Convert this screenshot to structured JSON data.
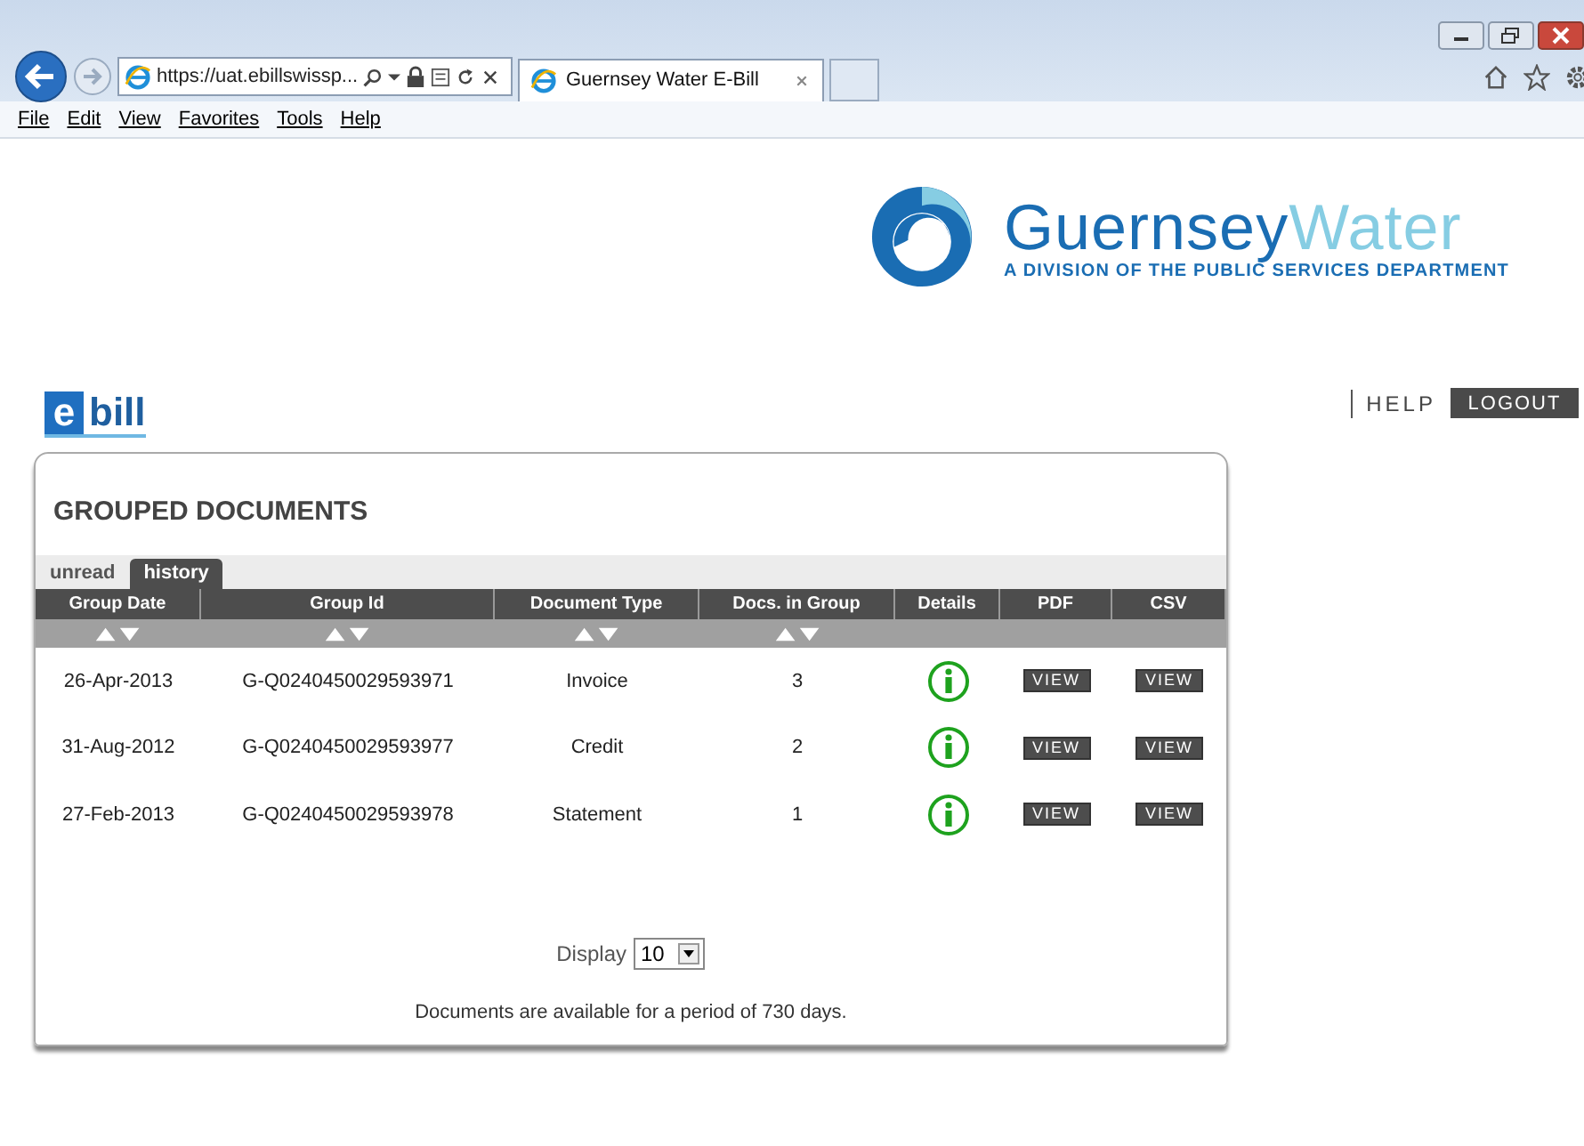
{
  "browser": {
    "address": "https://uat.ebillswissp...",
    "tab_title": "Guernsey Water E-Bill",
    "menu": [
      "File",
      "Edit",
      "View",
      "Favorites",
      "Tools",
      "Help"
    ]
  },
  "logo": {
    "name_part_1": "Guernsey",
    "name_part_2": "Water",
    "tagline": "A DIVISION OF THE PUBLIC SERVICES DEPARTMENT"
  },
  "ebill_logo": {
    "letter": "e",
    "word": "bill"
  },
  "top_links": {
    "help": "HELP",
    "logout": "LOGOUT"
  },
  "panel": {
    "title": "GROUPED DOCUMENTS",
    "tabs": [
      {
        "label": "unread",
        "selected": false
      },
      {
        "label": "history",
        "selected": true
      }
    ],
    "table": {
      "columns": [
        {
          "label": "Group Date",
          "sortable": true
        },
        {
          "label": "Group Id",
          "sortable": true
        },
        {
          "label": "Document Type",
          "sortable": true
        },
        {
          "label": "Docs. in Group",
          "sortable": true
        },
        {
          "label": "Details",
          "sortable": false
        },
        {
          "label": "PDF",
          "sortable": false
        },
        {
          "label": "CSV",
          "sortable": false
        }
      ],
      "rows": [
        {
          "group_date": "26-Apr-2013",
          "group_id": "G-Q0240450029593971",
          "document_type": "Invoice",
          "docs_in_group": "3",
          "pdf": "VIEW",
          "csv": "VIEW"
        },
        {
          "group_date": "31-Aug-2012",
          "group_id": "G-Q0240450029593977",
          "document_type": "Credit",
          "docs_in_group": "2",
          "pdf": "VIEW",
          "csv": "VIEW"
        },
        {
          "group_date": "27-Feb-2013",
          "group_id": "G-Q0240450029593978",
          "document_type": "Statement",
          "docs_in_group": "1",
          "pdf": "VIEW",
          "csv": "VIEW"
        }
      ]
    },
    "display": {
      "label": "Display",
      "value": "10"
    },
    "note": "Documents are available for a period of 730 days."
  }
}
